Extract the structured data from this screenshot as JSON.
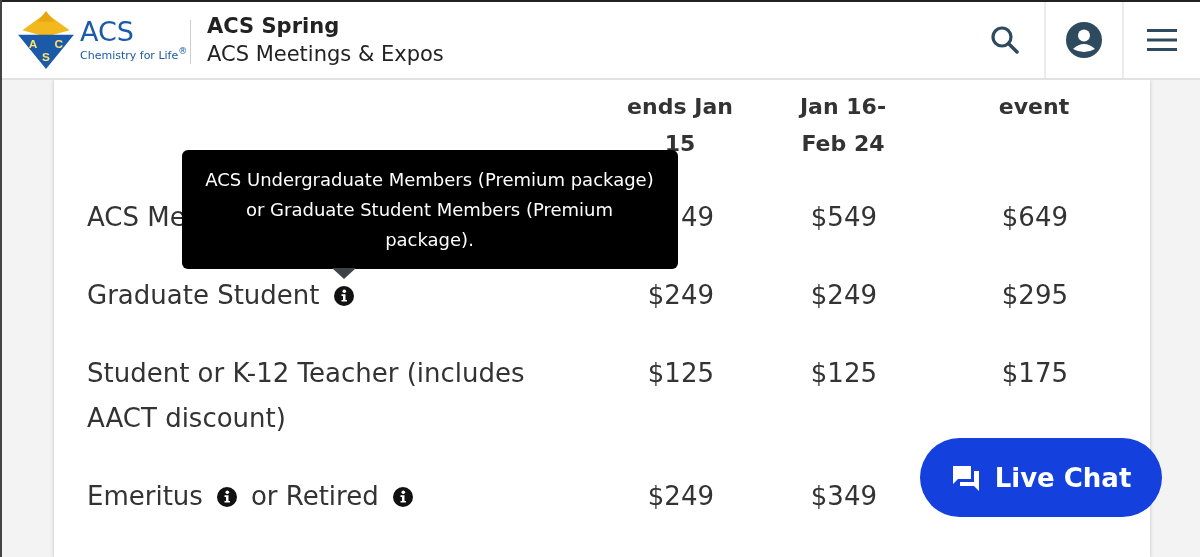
{
  "header": {
    "logo": {
      "emblem_letters": [
        "A",
        "C",
        "S"
      ],
      "wordmark": "ACS",
      "tagline": "Chemistry for Life$^{®}$"
    },
    "site_title": "ACS Spring",
    "site_subtitle": "ACS Meetings & Expos"
  },
  "table": {
    "columns": [
      "ends Jan 15",
      "Jan 16-Feb 24",
      "event"
    ],
    "rows": [
      {
        "label": [
          {
            "kind": "text",
            "text": "ACS Me"
          }
        ],
        "prices": [
          "49",
          "$549",
          "$649"
        ]
      },
      {
        "label": [
          {
            "kind": "text",
            "text": "Graduate Student"
          },
          {
            "kind": "info",
            "tooltip": "ACS Undergraduate Members (Premium package) or Graduate Student Members (Premium package)."
          }
        ],
        "prices": [
          "$249",
          "$249",
          "$295"
        ]
      },
      {
        "label": [
          {
            "kind": "text",
            "text": "Student or K-12 Teacher (includes AACT discount)"
          }
        ],
        "prices": [
          "$125",
          "$125",
          "$175"
        ]
      },
      {
        "label": [
          {
            "kind": "text",
            "text": "Emeritus"
          },
          {
            "kind": "info"
          },
          {
            "kind": "text",
            "text": "or Retired"
          },
          {
            "kind": "info"
          }
        ],
        "prices": [
          "$249",
          "$349"
        ]
      }
    ]
  },
  "live_chat": {
    "label": "Live Chat"
  }
}
